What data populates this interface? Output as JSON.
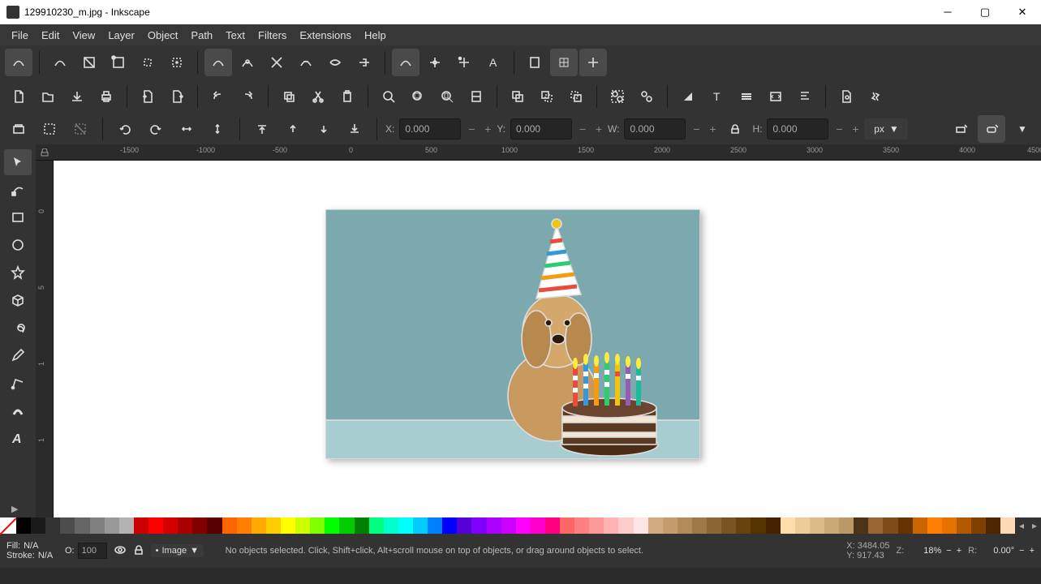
{
  "window": {
    "title": "129910230_m.jpg - Inkscape"
  },
  "menu": [
    "File",
    "Edit",
    "View",
    "Layer",
    "Object",
    "Path",
    "Text",
    "Filters",
    "Extensions",
    "Help"
  ],
  "coords": {
    "x": "0.000",
    "y": "0.000",
    "w": "0.000",
    "h": "0.000",
    "unit": "px"
  },
  "ruler_h": [
    {
      "v": "-1500",
      "p": 82
    },
    {
      "v": "-1000",
      "p": 176
    },
    {
      "v": "-500",
      "p": 270
    },
    {
      "v": "0",
      "p": 364
    },
    {
      "v": "500",
      "p": 458
    },
    {
      "v": "1000",
      "p": 552
    },
    {
      "v": "1500",
      "p": 646
    },
    {
      "v": "2000",
      "p": 740
    },
    {
      "v": "2500",
      "p": 834
    },
    {
      "v": "3000",
      "p": 928
    },
    {
      "v": "3500",
      "p": 1022
    },
    {
      "v": "4000",
      "p": 1116
    },
    {
      "v": "4500",
      "p": 1200
    }
  ],
  "ruler_v": [
    {
      "v": "0",
      "p": 60
    },
    {
      "v": "5",
      "p": 154
    },
    {
      "v": "1",
      "p": 248
    },
    {
      "v": "1",
      "p": 342
    }
  ],
  "palette": [
    "#000000",
    "#1a1a1a",
    "#333333",
    "#4d4d4d",
    "#666666",
    "#808080",
    "#999999",
    "#b3b3b3",
    "#cc0000",
    "#ff0000",
    "#d40000",
    "#aa0000",
    "#800000",
    "#550000",
    "#ff6600",
    "#ff8000",
    "#ffaa00",
    "#ffcc00",
    "#ffff00",
    "#ccff00",
    "#80ff00",
    "#00ff00",
    "#00cc00",
    "#008000",
    "#00ff80",
    "#00ffcc",
    "#00ffff",
    "#00ccff",
    "#0080ff",
    "#0000ff",
    "#5500d4",
    "#8000ff",
    "#aa00ff",
    "#cc00ff",
    "#ff00ff",
    "#ff00cc",
    "#ff0080",
    "#ff6666",
    "#ff8080",
    "#ff9999",
    "#ffb3b3",
    "#ffcccc",
    "#ffe6e6",
    "#d4aa80",
    "#c69c6d",
    "#b38a5a",
    "#a07847",
    "#8d6633",
    "#7a5420",
    "#66420d",
    "#553300",
    "#442200",
    "#ffddaa",
    "#eecc99",
    "#ddbb88",
    "#ccaa77",
    "#bb9966",
    "#4d3319",
    "#996633",
    "#804d1a",
    "#663300",
    "#cc6600",
    "#ff8000",
    "#e67300",
    "#b35900",
    "#804000",
    "#4d2600",
    "#ffd9b3"
  ],
  "status": {
    "fill": "N/A",
    "stroke": "N/A",
    "opacity": "100",
    "layer": "Image",
    "message": "No objects selected. Click, Shift+click, Alt+scroll mouse on top of objects, or drag around objects to select.",
    "cx": "3484.05",
    "cy": "917.43",
    "z": "Z:",
    "zoom": "18%",
    "r": "R:",
    "rot": "0.00°"
  }
}
